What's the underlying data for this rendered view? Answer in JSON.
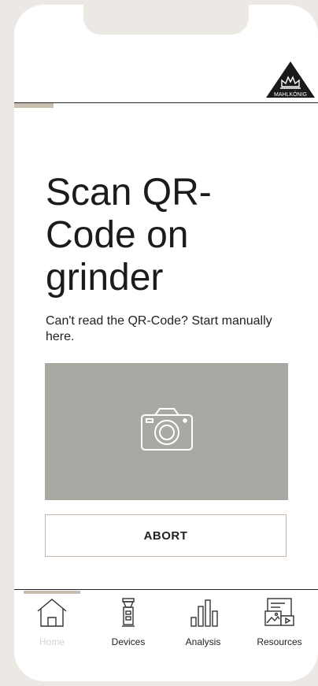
{
  "brand": {
    "logo_text": "MAHLKÖNIG"
  },
  "page": {
    "title": "Scan QR-Code on grinder",
    "subtitle": "Can't read the QR-Code? Start manually here."
  },
  "camera": {
    "icon": "camera-icon"
  },
  "actions": {
    "abort_label": "ABORT"
  },
  "nav": {
    "items": [
      {
        "label": "Home",
        "icon": "home-icon",
        "active": true
      },
      {
        "label": "Devices",
        "icon": "grinder-icon",
        "active": false
      },
      {
        "label": "Analysis",
        "icon": "bar-chart-icon",
        "active": false
      },
      {
        "label": "Resources",
        "icon": "resources-icon",
        "active": false
      }
    ]
  },
  "colors": {
    "background": "#ece9e5",
    "camera_area": "#a9a8a3",
    "accent": "#c9bfb0",
    "button_border": "#c9b6a4",
    "active_nav_text": "#d8d4cf"
  }
}
